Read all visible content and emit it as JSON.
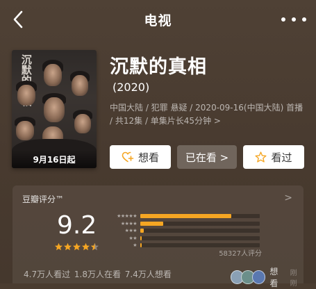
{
  "header": {
    "title": "电视",
    "back_icon": "chevron-left-icon",
    "more_icon": "more-dots-icon"
  },
  "poster": {
    "title_art": "沉默的真相",
    "date_banner": "9月16日起"
  },
  "show": {
    "title": "沉默的真相",
    "year": "(2020)",
    "meta": "中国大陆 / 犯罪 悬疑 / 2020-09-16(中国大陆) 首播 / 共12集 / 单集片长45分钟 >"
  },
  "actions": {
    "want_label": "想看",
    "watching_label": "已在看 >",
    "watched_label": "看过"
  },
  "rating": {
    "brand": "豆瓣评分™",
    "arrow": ">",
    "score": "9.2",
    "stars_filled": 4.5,
    "distribution_percent": [
      76,
      19,
      3,
      1,
      1
    ],
    "distribution_labels": [
      "★★★★★",
      "★★★★",
      "★★★",
      "★★",
      "★"
    ],
    "count_text": "58327人评分",
    "stats_text": "4.7万人看过 1.8万人在看 7.4万人想看",
    "friends_text": "想看",
    "friends_time": "刚刚"
  },
  "colors": {
    "accent": "#f5a623",
    "background": "#4a3c30"
  }
}
